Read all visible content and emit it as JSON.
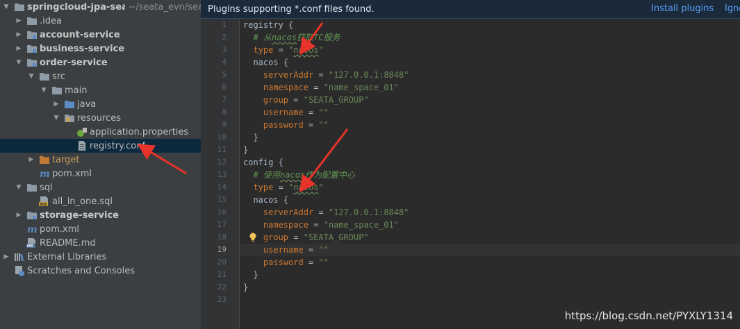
{
  "tree": {
    "items": [
      {
        "label": "springcloud-jpa-seata",
        "path": "~/seata_evn/sea",
        "depth": 0,
        "arrow": "down",
        "icon": "folder-icon",
        "bold": true
      },
      {
        "label": ".idea",
        "depth": 1,
        "arrow": "right",
        "icon": "folder-icon"
      },
      {
        "label": "account-service",
        "depth": 1,
        "arrow": "right",
        "icon": "module-folder-icon",
        "bold": true
      },
      {
        "label": "business-service",
        "depth": 1,
        "arrow": "right",
        "icon": "module-folder-icon",
        "bold": true
      },
      {
        "label": "order-service",
        "depth": 1,
        "arrow": "down",
        "icon": "module-folder-icon",
        "bold": true
      },
      {
        "label": "src",
        "depth": 2,
        "arrow": "down",
        "icon": "folder-icon"
      },
      {
        "label": "main",
        "depth": 3,
        "arrow": "down",
        "icon": "folder-icon"
      },
      {
        "label": "java",
        "depth": 4,
        "arrow": "right",
        "icon": "source-folder-icon"
      },
      {
        "label": "resources",
        "depth": 4,
        "arrow": "down",
        "icon": "resources-folder-icon"
      },
      {
        "label": "application.properties",
        "depth": 5,
        "arrow": "",
        "icon": "spring-properties-icon"
      },
      {
        "label": "registry.conf",
        "depth": 5,
        "arrow": "",
        "icon": "text-file-icon",
        "selected": true
      },
      {
        "label": "target",
        "depth": 2,
        "arrow": "right",
        "icon": "excluded-folder-icon",
        "orange": true
      },
      {
        "label": "pom.xml",
        "depth": 2,
        "arrow": "",
        "icon": "maven-icon"
      },
      {
        "label": "sql",
        "depth": 1,
        "arrow": "down",
        "icon": "folder-icon"
      },
      {
        "label": "all_in_one.sql",
        "depth": 2,
        "arrow": "",
        "icon": "sql-file-icon"
      },
      {
        "label": "storage-service",
        "depth": 1,
        "arrow": "right",
        "icon": "module-folder-icon",
        "bold": true
      },
      {
        "label": "pom.xml",
        "depth": 1,
        "arrow": "",
        "icon": "maven-icon"
      },
      {
        "label": "README.md",
        "depth": 1,
        "arrow": "",
        "icon": "markdown-file-icon"
      },
      {
        "label": "External Libraries",
        "depth": 0,
        "arrow": "right",
        "icon": "libraries-icon"
      },
      {
        "label": "Scratches and Consoles",
        "depth": 0,
        "arrow": "",
        "icon": "scratches-icon"
      }
    ]
  },
  "banner": {
    "message": "Plugins supporting *.conf files found.",
    "install": "Install plugins",
    "ignore": "Igno"
  },
  "editor": {
    "current_line": 19,
    "lines": [
      [
        {
          "t": "registry {"
        }
      ],
      [
        {
          "t": "  "
        },
        {
          "t": "# 从",
          "c": "c"
        },
        {
          "t": "nacos",
          "c": "c w"
        },
        {
          "t": "获取TC服务",
          "c": "c"
        }
      ],
      [
        {
          "t": "  "
        },
        {
          "t": "type",
          "c": "k"
        },
        {
          "t": " = "
        },
        {
          "t": "\"",
          "c": "s"
        },
        {
          "t": "nacos",
          "c": "s w"
        },
        {
          "t": "\"",
          "c": "s"
        }
      ],
      [
        {
          "t": "  nacos {"
        }
      ],
      [
        {
          "t": "    "
        },
        {
          "t": "serverAddr",
          "c": "k"
        },
        {
          "t": " = "
        },
        {
          "t": "\"127.0.0.1:8848\"",
          "c": "s"
        }
      ],
      [
        {
          "t": "    "
        },
        {
          "t": "namespace",
          "c": "k"
        },
        {
          "t": " = "
        },
        {
          "t": "\"name_space_01\"",
          "c": "s"
        }
      ],
      [
        {
          "t": "    "
        },
        {
          "t": "group",
          "c": "k"
        },
        {
          "t": " = "
        },
        {
          "t": "\"SEATA_GROUP\"",
          "c": "s"
        }
      ],
      [
        {
          "t": "    "
        },
        {
          "t": "username",
          "c": "k"
        },
        {
          "t": " = "
        },
        {
          "t": "\"\"",
          "c": "s"
        }
      ],
      [
        {
          "t": "    "
        },
        {
          "t": "password",
          "c": "k"
        },
        {
          "t": " = "
        },
        {
          "t": "\"\"",
          "c": "s"
        }
      ],
      [
        {
          "t": "  }"
        }
      ],
      [
        {
          "t": "}"
        }
      ],
      [
        {
          "t": "config {"
        }
      ],
      [
        {
          "t": "  "
        },
        {
          "t": "# 使用",
          "c": "c"
        },
        {
          "t": "nacos",
          "c": "c w"
        },
        {
          "t": "作为配置中心",
          "c": "c"
        }
      ],
      [
        {
          "t": "  "
        },
        {
          "t": "type",
          "c": "k"
        },
        {
          "t": " = "
        },
        {
          "t": "\"",
          "c": "s"
        },
        {
          "t": "nacos",
          "c": "s w"
        },
        {
          "t": "\"",
          "c": "s"
        }
      ],
      [
        {
          "t": "  nacos {"
        }
      ],
      [
        {
          "t": "    "
        },
        {
          "t": "serverAddr",
          "c": "k"
        },
        {
          "t": " = "
        },
        {
          "t": "\"127.0.0.1:8848\"",
          "c": "s"
        }
      ],
      [
        {
          "t": "    "
        },
        {
          "t": "namespace",
          "c": "k"
        },
        {
          "t": " = "
        },
        {
          "t": "\"name_space_01\"",
          "c": "s"
        }
      ],
      [
        {
          "t": "    "
        },
        {
          "t": "group",
          "c": "k"
        },
        {
          "t": " = "
        },
        {
          "t": "\"SEATA_GROUP\"",
          "c": "s"
        }
      ],
      [
        {
          "t": "    "
        },
        {
          "t": "username",
          "c": "k"
        },
        {
          "t": " = "
        },
        {
          "t": "\"\"",
          "c": "s"
        }
      ],
      [
        {
          "t": "    "
        },
        {
          "t": "password",
          "c": "k"
        },
        {
          "t": " = "
        },
        {
          "t": "\"\"",
          "c": "s"
        }
      ],
      [
        {
          "t": "  }"
        }
      ],
      [
        {
          "t": "}"
        }
      ],
      [
        {
          "t": ""
        }
      ]
    ]
  },
  "watermark": "https://blog.csdn.net/PYXLY1314",
  "colors": {
    "annotation_arrow": "#e8332a",
    "selection": "#0d293e"
  }
}
